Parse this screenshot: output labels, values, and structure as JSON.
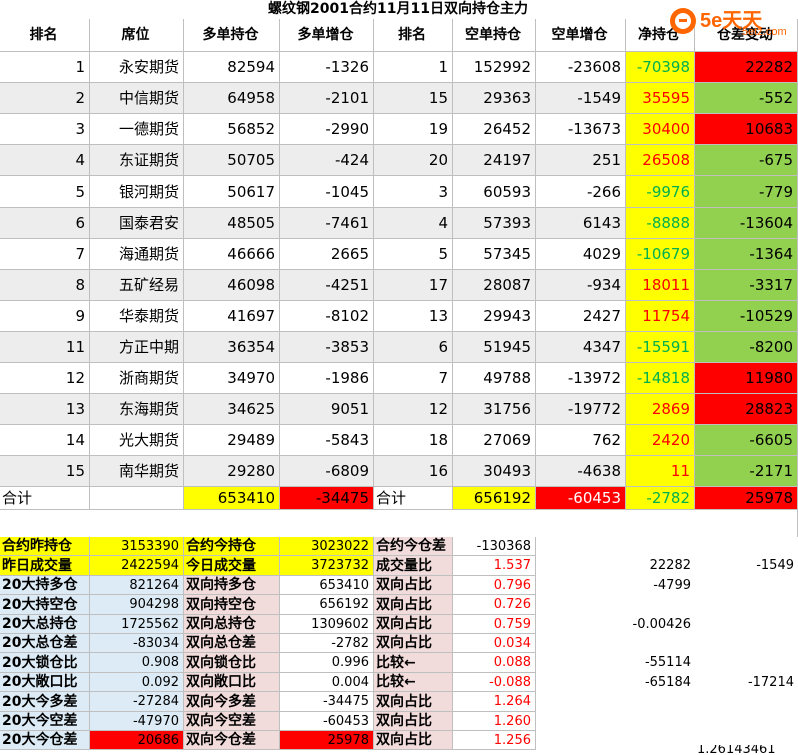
{
  "title": "螺纹钢2001合约11月11日双向持仓主力",
  "logo": {
    "brand": "5e天天",
    "sub": "5etz.com"
  },
  "headers": [
    "排名",
    "席位",
    "多单持仓",
    "多单增仓",
    "排名",
    "空单持仓",
    "空单增仓",
    "净持仓",
    "仓差变动"
  ],
  "rows": [
    {
      "r1": "1",
      "name": "永安期货",
      "long": "82594",
      "long_chg": "-1326",
      "r2": "1",
      "short": "152992",
      "short_chg": "-23608",
      "net": "-70398",
      "diff": "22282"
    },
    {
      "r1": "2",
      "name": "中信期货",
      "long": "64958",
      "long_chg": "-2101",
      "r2": "15",
      "short": "29363",
      "short_chg": "-1549",
      "net": "35595",
      "diff": "-552"
    },
    {
      "r1": "3",
      "name": "一德期货",
      "long": "56852",
      "long_chg": "-2990",
      "r2": "19",
      "short": "26452",
      "short_chg": "-13673",
      "net": "30400",
      "diff": "10683"
    },
    {
      "r1": "4",
      "name": "东证期货",
      "long": "50705",
      "long_chg": "-424",
      "r2": "20",
      "short": "24197",
      "short_chg": "251",
      "net": "26508",
      "diff": "-675"
    },
    {
      "r1": "5",
      "name": "银河期货",
      "long": "50617",
      "long_chg": "-1045",
      "r2": "3",
      "short": "60593",
      "short_chg": "-266",
      "net": "-9976",
      "diff": "-779"
    },
    {
      "r1": "6",
      "name": "国泰君安",
      "long": "48505",
      "long_chg": "-7461",
      "r2": "4",
      "short": "57393",
      "short_chg": "6143",
      "net": "-8888",
      "diff": "-13604"
    },
    {
      "r1": "7",
      "name": "海通期货",
      "long": "46666",
      "long_chg": "2665",
      "r2": "5",
      "short": "57345",
      "short_chg": "4029",
      "net": "-10679",
      "diff": "-1364"
    },
    {
      "r1": "8",
      "name": "五矿经易",
      "long": "46098",
      "long_chg": "-4251",
      "r2": "17",
      "short": "28087",
      "short_chg": "-934",
      "net": "18011",
      "diff": "-3317"
    },
    {
      "r1": "9",
      "name": "华泰期货",
      "long": "41697",
      "long_chg": "-8102",
      "r2": "13",
      "short": "29943",
      "short_chg": "2427",
      "net": "11754",
      "diff": "-10529"
    },
    {
      "r1": "11",
      "name": "方正中期",
      "long": "36354",
      "long_chg": "-3853",
      "r2": "6",
      "short": "51945",
      "short_chg": "4347",
      "net": "-15591",
      "diff": "-8200"
    },
    {
      "r1": "12",
      "name": "浙商期货",
      "long": "34970",
      "long_chg": "-1986",
      "r2": "7",
      "short": "49788",
      "short_chg": "-13972",
      "net": "-14818",
      "diff": "11980"
    },
    {
      "r1": "13",
      "name": "东海期货",
      "long": "34625",
      "long_chg": "9051",
      "r2": "12",
      "short": "31756",
      "short_chg": "-19772",
      "net": "2869",
      "diff": "28823"
    },
    {
      "r1": "14",
      "name": "光大期货",
      "long": "29489",
      "long_chg": "-5843",
      "r2": "18",
      "short": "27069",
      "short_chg": "762",
      "net": "2420",
      "diff": "-6605"
    },
    {
      "r1": "15",
      "name": "南华期货",
      "long": "29280",
      "long_chg": "-6809",
      "r2": "16",
      "short": "30493",
      "short_chg": "-4638",
      "net": "11",
      "diff": "-2171"
    }
  ],
  "total": {
    "label1": "合计",
    "long": "653410",
    "long_chg": "-34475",
    "label2": "合计",
    "short": "656192",
    "short_chg": "-60453",
    "net": "-2782",
    "diff": "25978"
  },
  "summary": [
    {
      "l1": "合约昨持仓",
      "v1": "3153390",
      "l2": "合约今持仓",
      "v2": "3023022",
      "l3": "合约今仓差",
      "v3": "-130368",
      "e1": "",
      "e2": ""
    },
    {
      "l1": "昨日成交量",
      "v1": "2422594",
      "l2": "今日成交量",
      "v2": "3723732",
      "l3": "成交量比",
      "v3": "1.537",
      "e1": "22282",
      "e2": "-1549"
    },
    {
      "l1": "20大持多仓",
      "v1": "821264",
      "l2": "双向持多仓",
      "v2": "653410",
      "l3": "双向占比",
      "v3": "0.796",
      "e1": "-4799",
      "e2": ""
    },
    {
      "l1": "20大持空仓",
      "v1": "904298",
      "l2": "双向持空仓",
      "v2": "656192",
      "l3": "双向占比",
      "v3": "0.726",
      "e1": "",
      "e2": ""
    },
    {
      "l1": "20大总持仓",
      "v1": "1725562",
      "l2": "双向总持仓",
      "v2": "1309602",
      "l3": "双向占比",
      "v3": "0.759",
      "e1": "-0.00426",
      "e2": ""
    },
    {
      "l1": "20大总仓差",
      "v1": "-83034",
      "l2": "双向总仓差",
      "v2": "-2782",
      "l3": "双向占比",
      "v3": "0.034",
      "e1": "",
      "e2": ""
    },
    {
      "l1": "20大锁仓比",
      "v1": "0.908",
      "l2": "双向锁仓比",
      "v2": "0.996",
      "l3": "比较←",
      "v3": "0.088",
      "e1": "-55114",
      "e2": ""
    },
    {
      "l1": "20大敞口比",
      "v1": "0.092",
      "l2": "双向敞口比",
      "v2": "0.004",
      "l3": "比较←",
      "v3": "-0.088",
      "e1": "-65184",
      "e2": "-17214"
    },
    {
      "l1": "20大今多差",
      "v1": "-27284",
      "l2": "双向今多差",
      "v2": "-34475",
      "l3": "双向占比",
      "v3": "1.264",
      "e1": "",
      "e2": ""
    },
    {
      "l1": "20大今空差",
      "v1": "-47970",
      "l2": "双向今空差",
      "v2": "-60453",
      "l3": "双向占比",
      "v3": "1.260",
      "e1": "",
      "e2": ""
    },
    {
      "l1": "20大今仓差",
      "v1": "20686",
      "l2": "双向今仓差",
      "v2": "25978",
      "l3": "双向占比",
      "v3": "1.256",
      "e1": "",
      "e2": ""
    }
  ],
  "footer_value": "1.26143461",
  "colors": {
    "yellow": "#ffff00",
    "red": "#ff0000",
    "green": "#92d050",
    "grey": "#ededed",
    "lightblue": "#dcebf5",
    "pink": "#f2dcdb"
  }
}
